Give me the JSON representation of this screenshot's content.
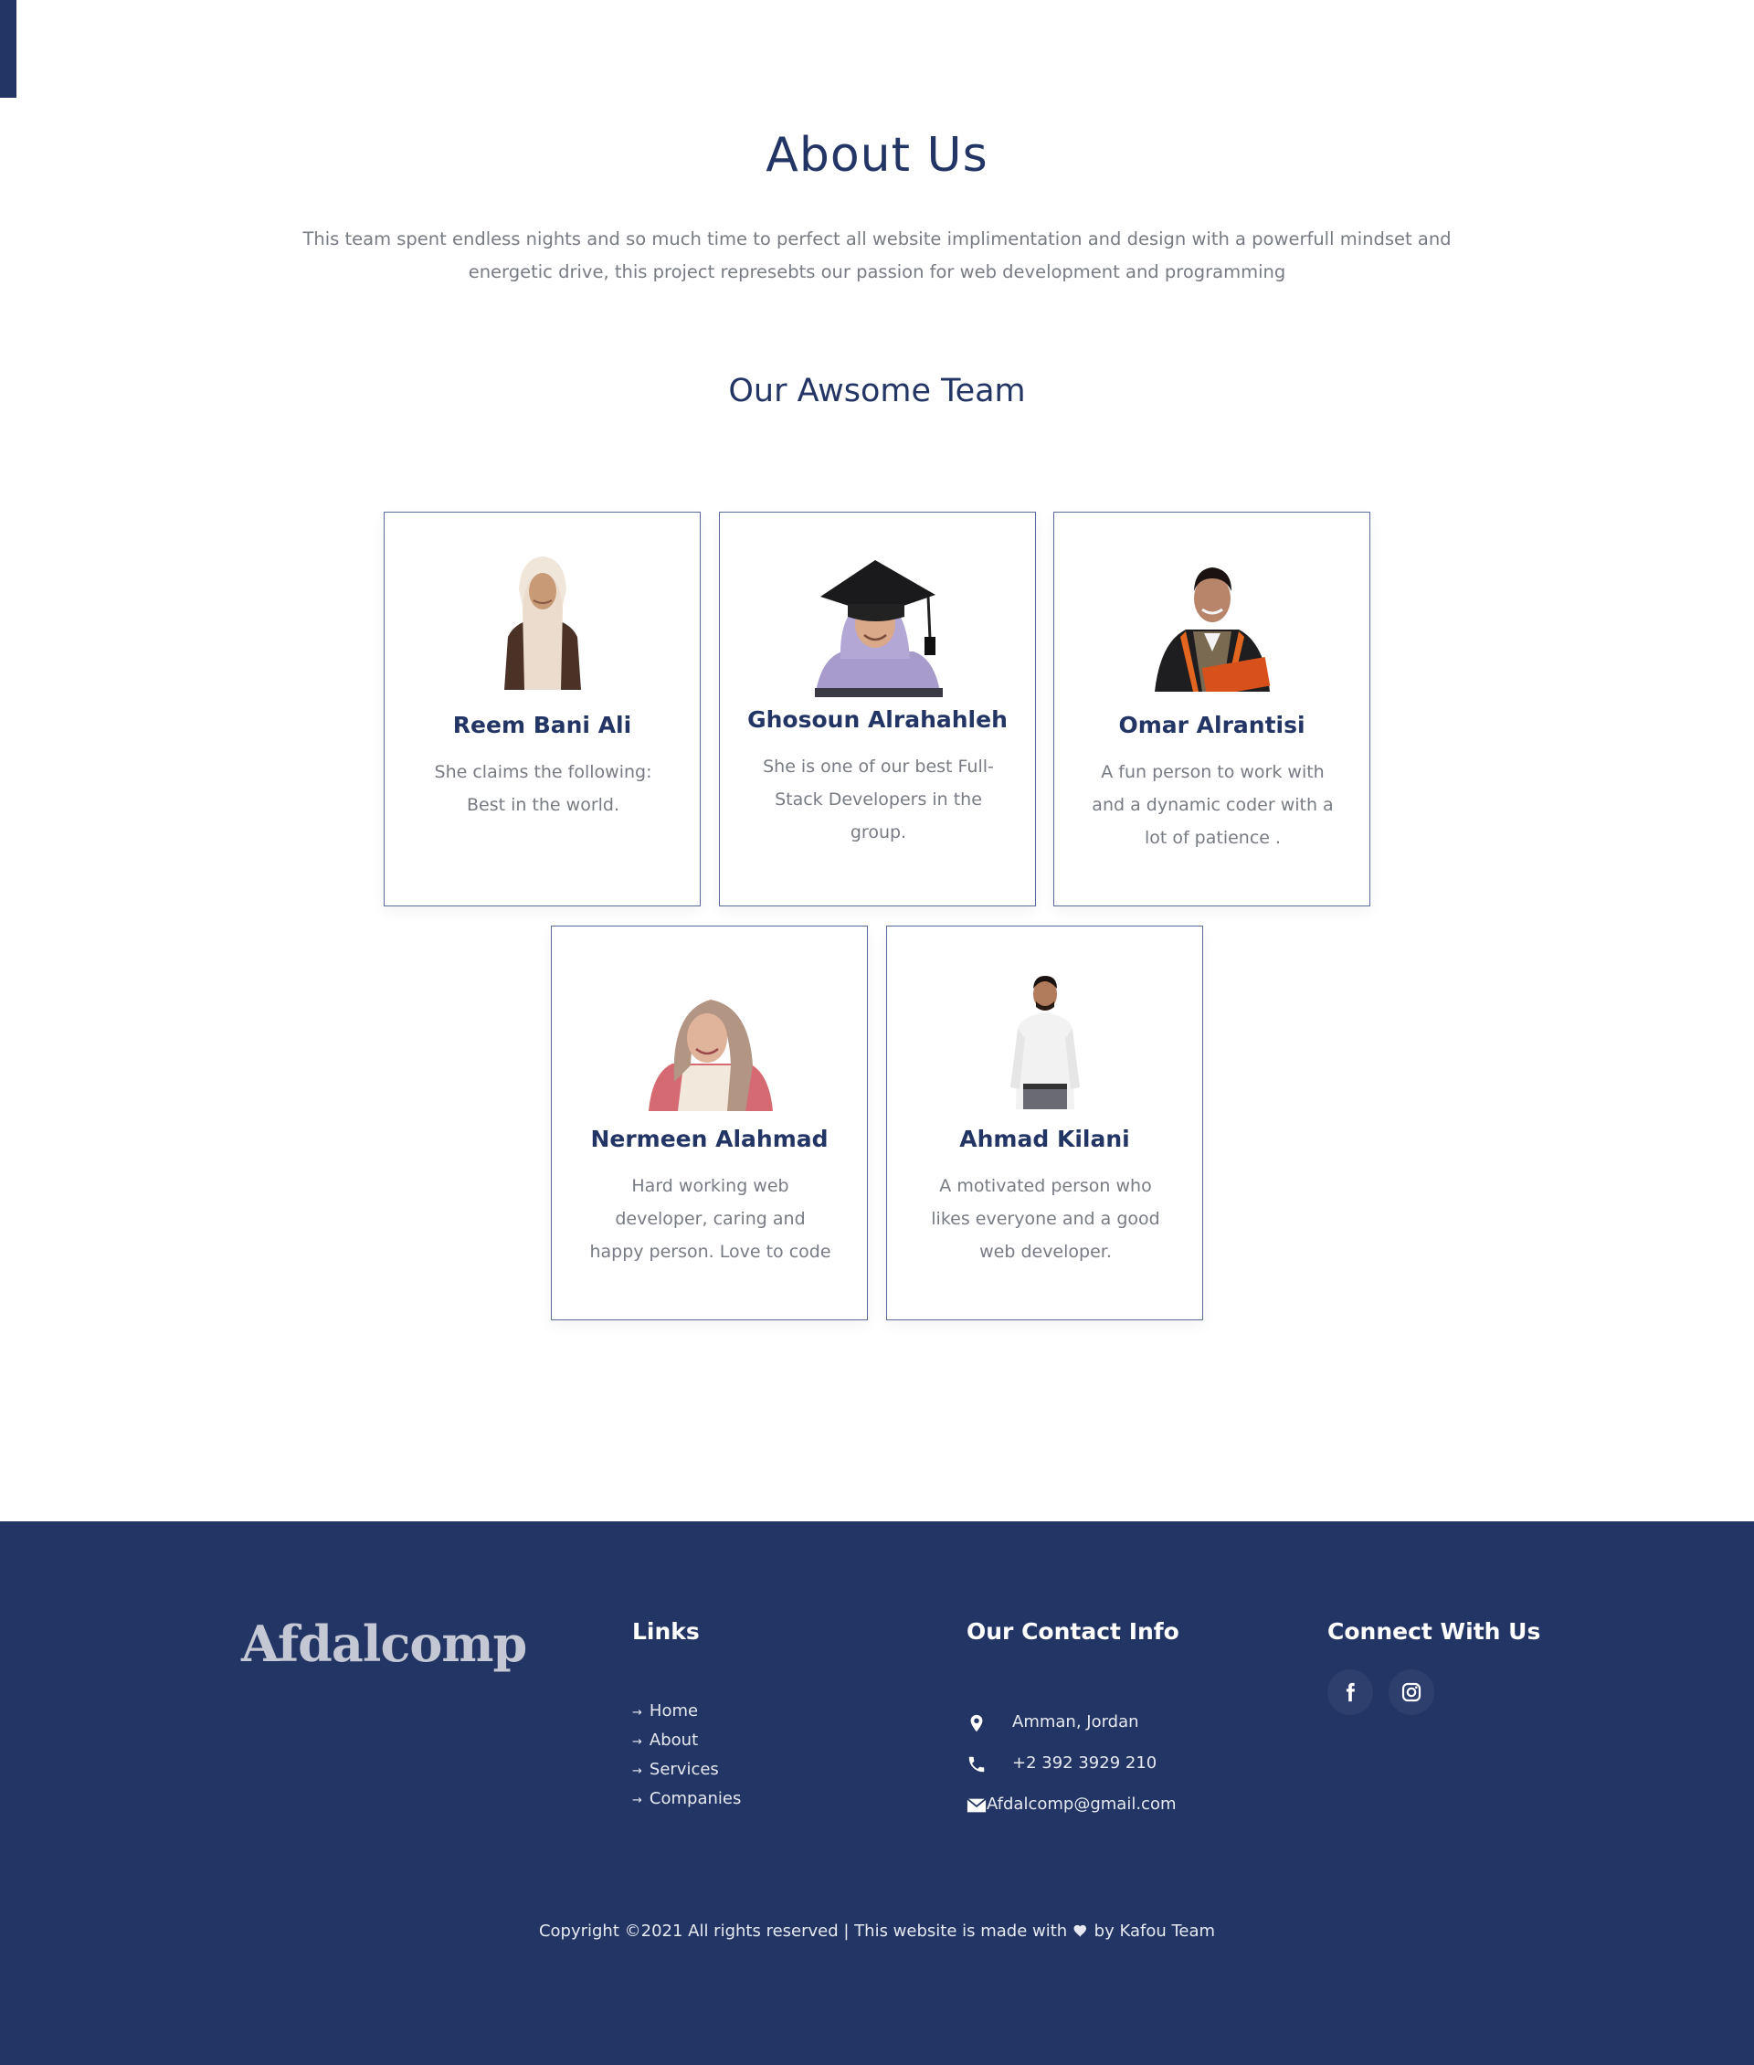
{
  "about": {
    "title": "About Us",
    "intro": "This team spent endless nights and so much time to perfect all website implimentation and design with a powerfull mindset and energetic drive, this project represebts our passion for web development and programming",
    "team_title": "Our Awsome Team"
  },
  "team": [
    {
      "name": "Reem Bani Ali",
      "desc": "She claims the following: Best in the world."
    },
    {
      "name": "Ghosoun Alrahahleh",
      "desc": "She is one of our best Full-Stack Developers in the group."
    },
    {
      "name": "Omar Alrantisi",
      "desc": "A fun person to work with and a dynamic coder with a lot of patience ."
    },
    {
      "name": "Nermeen Alahmad",
      "desc": "Hard working web developer, caring and happy person. Love to code"
    },
    {
      "name": "Ahmad Kilani",
      "desc": "A motivated person who likes everyone and a good web developer."
    }
  ],
  "footer": {
    "logo": "Afdalcomp",
    "links_title": "Links",
    "links": [
      "Home",
      "About",
      "Services",
      "Companies"
    ],
    "contact_title": "Our Contact Info",
    "contact": {
      "address": "Amman, Jordan",
      "phone": "+2 392 3929 210",
      "email": "Afdalcomp@gmail.com"
    },
    "connect_title": "Connect With Us",
    "social_icons": [
      "facebook-icon",
      "instagram-icon"
    ],
    "copyright_before": "Copyright ©2021 All rights reserved | This website is made with",
    "copyright_after": "by Kafou Team"
  },
  "colors": {
    "navy": "#233564",
    "muted_text": "#777b83"
  }
}
